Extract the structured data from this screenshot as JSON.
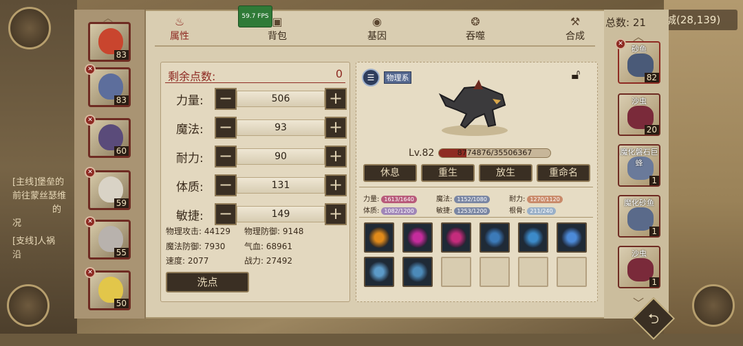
{
  "hud": {
    "fps": "59.7 FPS",
    "coords": "城(28,139)"
  },
  "background": {
    "quests": [
      {
        "label": "[主线]堡垒的",
        "detail": "前往蒙丝瑟维",
        "tail": "的",
        "end": "况"
      },
      {
        "label": "[支线]人祸",
        "detail": "沿"
      }
    ]
  },
  "tabs": [
    {
      "label": "属性",
      "icon": "flame-icon",
      "active": true
    },
    {
      "label": "背包",
      "icon": "bag-icon",
      "active": false
    },
    {
      "label": "基因",
      "icon": "eye-icon",
      "active": false
    },
    {
      "label": "吞噬",
      "icon": "devour-icon",
      "active": false
    },
    {
      "label": "合成",
      "icon": "forge-icon",
      "active": false
    }
  ],
  "party": [
    {
      "level": "83",
      "color": "#c9452e"
    },
    {
      "level": "83",
      "color": "#5d6e9c"
    },
    {
      "level": "60",
      "color": "#5a4b7a"
    },
    {
      "level": "59",
      "color": "#d9d3c6"
    },
    {
      "level": "55",
      "color": "#b8b2ad"
    },
    {
      "level": "50",
      "color": "#e2c64a"
    }
  ],
  "attributes": {
    "remaining_label": "剩余点数:",
    "remaining_value": "0",
    "rows": [
      {
        "label": "力量:",
        "value": "506"
      },
      {
        "label": "魔法:",
        "value": "93"
      },
      {
        "label": "耐力:",
        "value": "90"
      },
      {
        "label": "体质:",
        "value": "131"
      },
      {
        "label": "敏捷:",
        "value": "149"
      }
    ],
    "derived": [
      {
        "text": "物理攻击: 44129"
      },
      {
        "text": "物理防御: 9148"
      },
      {
        "text": "魔法防御: 7930"
      },
      {
        "text": "气血: 68961"
      },
      {
        "text": "速度: 2077"
      },
      {
        "text": "战力: 27492"
      }
    ],
    "reset_label": "洗点"
  },
  "pet": {
    "type_tag": "物理系",
    "level": "Lv.82",
    "exp_text": "8774876/35506367",
    "exp_fraction": 0.247,
    "buttons": [
      "休息",
      "重生",
      "放生",
      "重命名"
    ],
    "talents": [
      {
        "label": "力量:",
        "value": "1613/1640",
        "color": "#b85a7a"
      },
      {
        "label": "魔法:",
        "value": "1152/1080",
        "color": "#7a86a3"
      },
      {
        "label": "耐力:",
        "value": "1270/1120",
        "color": "#c98a6a"
      },
      {
        "label": "体质:",
        "value": "1082/1200",
        "color": "#a086b8"
      },
      {
        "label": "敏捷:",
        "value": "1253/1200",
        "color": "#7a86a3"
      },
      {
        "label": "根骨:",
        "value": "211/240",
        "color": "#9ab0c8"
      }
    ],
    "skills": [
      {
        "name": "sun-skill-icon",
        "color": "#e08a1a"
      },
      {
        "name": "magenta-burst-skill-icon",
        "color": "#c42c9c"
      },
      {
        "name": "magenta-claw-skill-icon",
        "color": "#c42c7c"
      },
      {
        "name": "blue-orb-skill-icon",
        "color": "#3c7ab8"
      },
      {
        "name": "blue-spark-skill-icon",
        "color": "#3c8ac8"
      },
      {
        "name": "blue-ring-skill-icon",
        "color": "#4c8ad8"
      },
      {
        "name": "ice-shard-skill-icon",
        "color": "#5c9ac8"
      },
      {
        "name": "wind-slash-skill-icon",
        "color": "#4c8ab8"
      },
      {
        "name": "",
        "color": ""
      },
      {
        "name": "",
        "color": ""
      },
      {
        "name": "",
        "color": ""
      },
      {
        "name": "",
        "color": ""
      }
    ]
  },
  "roster": {
    "total_label": "总数: 21",
    "items": [
      {
        "name": "砂鱼",
        "count": "82",
        "color": "#4a5a78"
      },
      {
        "name": "沙虫",
        "count": "20",
        "color": "#7a2a3a"
      },
      {
        "name": "魔化磐石巨蜂",
        "count": "1",
        "color": "#6a7a9a"
      },
      {
        "name": "魔化砂鱼",
        "count": "1",
        "color": "#5a6a8a"
      },
      {
        "name": "沙虫",
        "count": "1",
        "color": "#7a2a3a"
      }
    ]
  }
}
